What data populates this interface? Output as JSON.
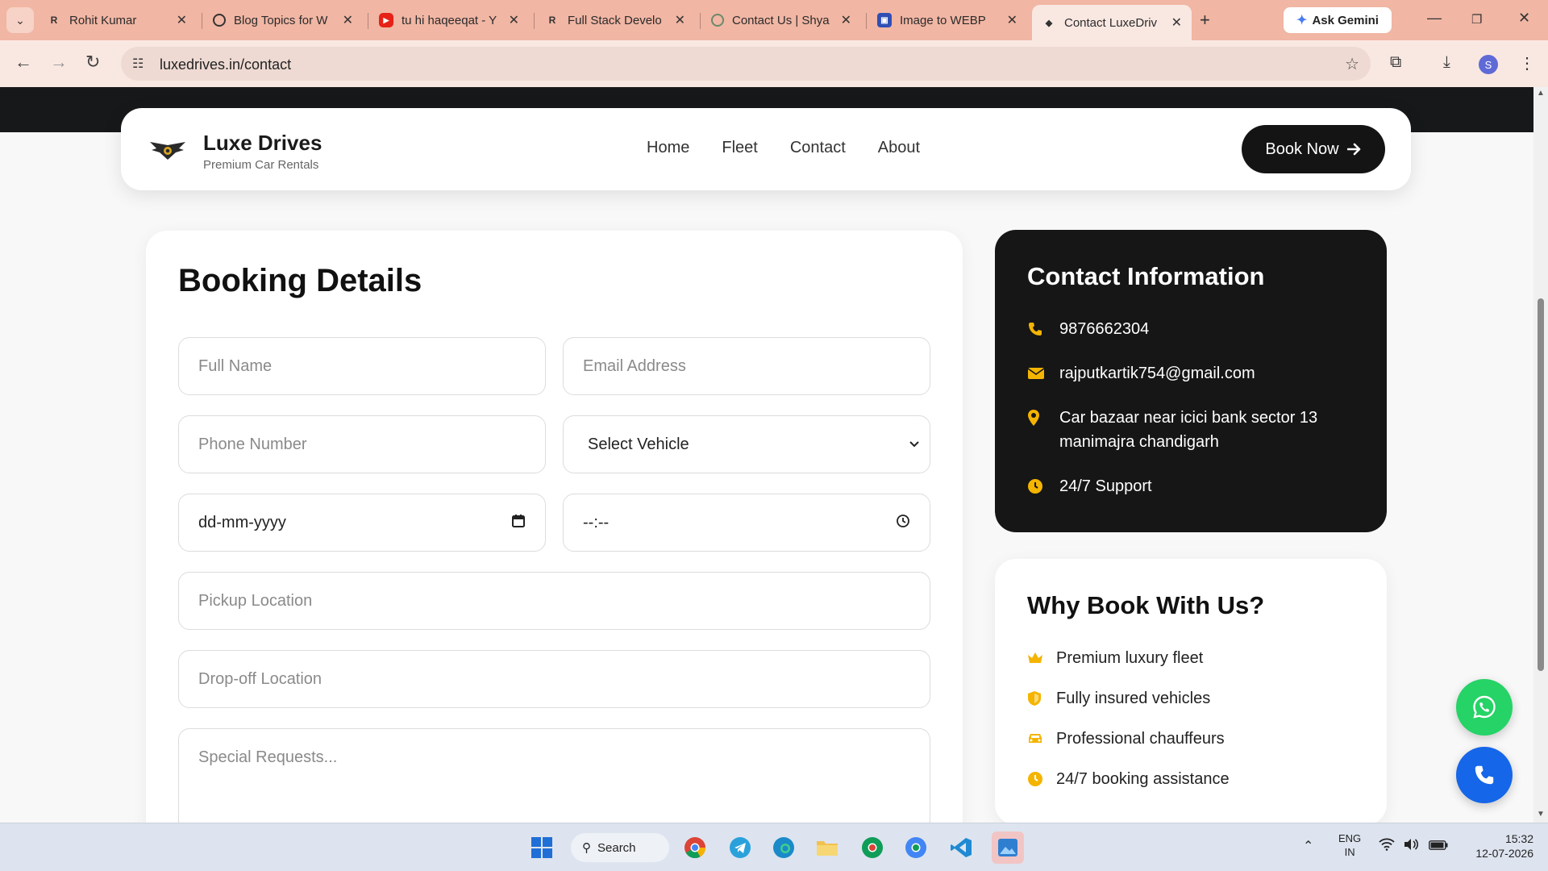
{
  "browser": {
    "tabs": [
      {
        "title": "Rohit Kumar",
        "icon": "rk-logo-icon",
        "active": false
      },
      {
        "title": "Blog Topics for W",
        "icon": "openai-icon",
        "active": false
      },
      {
        "title": "tu hi haqeeqat - Y",
        "icon": "youtube-icon",
        "active": false
      },
      {
        "title": "Full Stack Develo",
        "icon": "rk-logo-icon",
        "active": false
      },
      {
        "title": "Contact Us | Shya",
        "icon": "globe-icon",
        "active": false
      },
      {
        "title": "Image to WEBP",
        "icon": "image-icon",
        "active": false
      },
      {
        "title": "Contact LuxeDriv",
        "icon": "luxe-logo-icon",
        "active": true
      }
    ],
    "gemini_label": "Ask Gemini",
    "url": "luxedrives.in/contact",
    "profile_initial": "S"
  },
  "header": {
    "brand_name": "Luxe Drives",
    "brand_tagline": "Premium Car Rentals",
    "nav": [
      "Home",
      "Fleet",
      "Contact",
      "About"
    ],
    "book_now": "Book Now"
  },
  "booking_form": {
    "title": "Booking Details",
    "full_name_placeholder": "Full Name",
    "email_placeholder": "Email Address",
    "phone_placeholder": "Phone Number",
    "vehicle_select_value": "Select Vehicle",
    "date_placeholder": "dd-mm-yyyy",
    "time_placeholder": "--:--",
    "pickup_placeholder": "Pickup Location",
    "dropoff_placeholder": "Drop-off Location",
    "special_requests_placeholder": "Special Requests..."
  },
  "contact_info": {
    "title": "Contact Information",
    "phone": "9876662304",
    "email": "rajputkartik754@gmail.com",
    "address": "Car bazaar near icici bank sector 13 manimajra chandigarh",
    "support": "24/7 Support"
  },
  "why_book": {
    "title": "Why Book With Us?",
    "items": [
      "Premium luxury fleet",
      "Fully insured vehicles",
      "Professional chauffeurs",
      "24/7 booking assistance"
    ]
  },
  "taskbar": {
    "search_label": "Search",
    "lang_top": "ENG",
    "lang_bottom": "IN",
    "time": "15:32",
    "date": "12-07-2026"
  },
  "colors": {
    "accent_gold": "#f4b400",
    "dark": "#161616",
    "whatsapp": "#25d366",
    "call": "#1566e8",
    "tab_strip": "#f1b6a4"
  }
}
